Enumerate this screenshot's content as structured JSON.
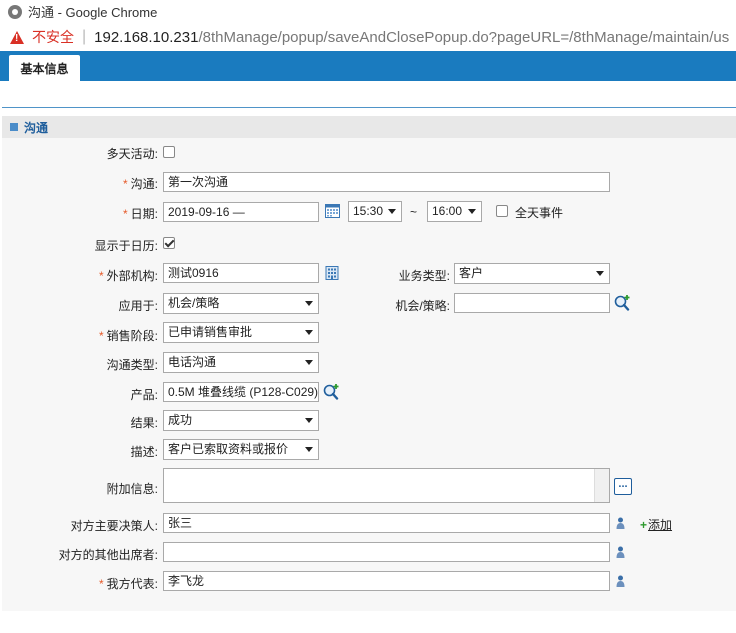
{
  "window": {
    "title": "沟通 - Google Chrome"
  },
  "address": {
    "security_label": "不安全",
    "url_host": "192.168.10.231",
    "url_path": "/8thManage/popup/saveAndClosePopup.do?pageURL=/8thManage/maintain/us"
  },
  "tabs": [
    {
      "label": "基本信息"
    }
  ],
  "section": {
    "title": "沟通"
  },
  "form": {
    "multi_day": {
      "label": "多天活动:",
      "checked": false
    },
    "subject": {
      "label": "沟通:",
      "value": "第一次沟通"
    },
    "date": {
      "label": "日期:",
      "value": "2019-09-16 —",
      "start_time": "15:30",
      "tilde": "~",
      "end_time": "16:00",
      "all_day_label": "全天事件"
    },
    "show_calendar": {
      "label": "显示于日历:",
      "checked": true
    },
    "external_org": {
      "label": "外部机构:",
      "value": "测试0916"
    },
    "business_type": {
      "label": "业务类型:",
      "value": "客户"
    },
    "applies_to": {
      "label": "应用于:",
      "value": "机会/策略"
    },
    "opportunity": {
      "label": "机会/策略:",
      "value": ""
    },
    "sales_stage": {
      "label": "销售阶段:",
      "value": "已申请销售审批"
    },
    "comm_type": {
      "label": "沟通类型:",
      "value": "电话沟通"
    },
    "product": {
      "label": "产品:",
      "value": "0.5M 堆叠线缆 (P128-C029)"
    },
    "result": {
      "label": "结果:",
      "value": "成功"
    },
    "description": {
      "label": "描述:",
      "value": "客户已索取资料或报价"
    },
    "extra_info": {
      "label": "附加信息:",
      "value": "",
      "more_button": "..."
    },
    "decision_maker": {
      "label": "对方主要决策人:",
      "value": "张三",
      "add_label": "添加"
    },
    "other_attendees": {
      "label": "对方的其他出席者:",
      "value": ""
    },
    "our_rep": {
      "label": "我方代表:",
      "value": "李飞龙"
    }
  },
  "colors": {
    "accent": "#1a7bbf",
    "required": "#e65a2a",
    "section_text": "#1f5e9c"
  }
}
